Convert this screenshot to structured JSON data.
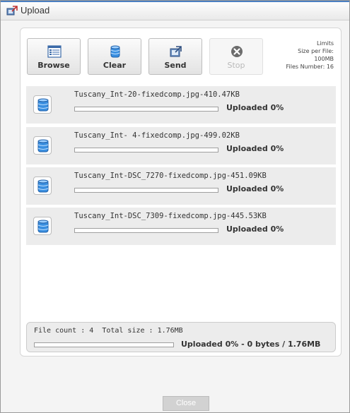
{
  "window": {
    "title": "Upload",
    "icon": "upload-app-icon"
  },
  "toolbar": {
    "buttons": [
      {
        "label": "Browse",
        "icon": "browse-list-icon",
        "enabled": true
      },
      {
        "label": "Clear",
        "icon": "clear-database-icon",
        "enabled": true
      },
      {
        "label": "Send",
        "icon": "send-icon",
        "enabled": true
      },
      {
        "label": "Stop",
        "icon": "stop-icon",
        "enabled": false
      }
    ],
    "limits": {
      "heading": "Limits",
      "size_label": "Size per File:",
      "size_value": "100MB",
      "files_label": "Files Number: 16"
    }
  },
  "files": [
    {
      "name": "Tuscany_Int-20-fixedcomp.jpg-410.47KB",
      "status_label": "Uploaded",
      "progress": "0%",
      "icon": "file-database-icon"
    },
    {
      "name": "Tuscany_Int- 4-fixedcomp.jpg-499.02KB",
      "status_label": "Uploaded",
      "progress": "0%",
      "icon": "file-database-icon"
    },
    {
      "name": "Tuscany_Int-DSC_7270-fixedcomp.jpg-451.09KB",
      "status_label": "Uploaded",
      "progress": "0%",
      "icon": "file-database-icon"
    },
    {
      "name": "Tuscany_Int-DSC_7309-fixedcomp.jpg-445.53KB",
      "status_label": "Uploaded",
      "progress": "0%",
      "icon": "file-database-icon"
    }
  ],
  "summary": {
    "count_label": "File count :",
    "count_value": "4",
    "size_label": "Total size :",
    "size_value": "1.76MB",
    "status": "Uploaded 0% - 0 bytes / 1.76MB",
    "progress": 0
  },
  "footer": {
    "close_label": "Close"
  },
  "colors": {
    "accent": "#4a7fc1",
    "item_bg": "#ececec",
    "disabled_text": "#b9b9b9"
  }
}
